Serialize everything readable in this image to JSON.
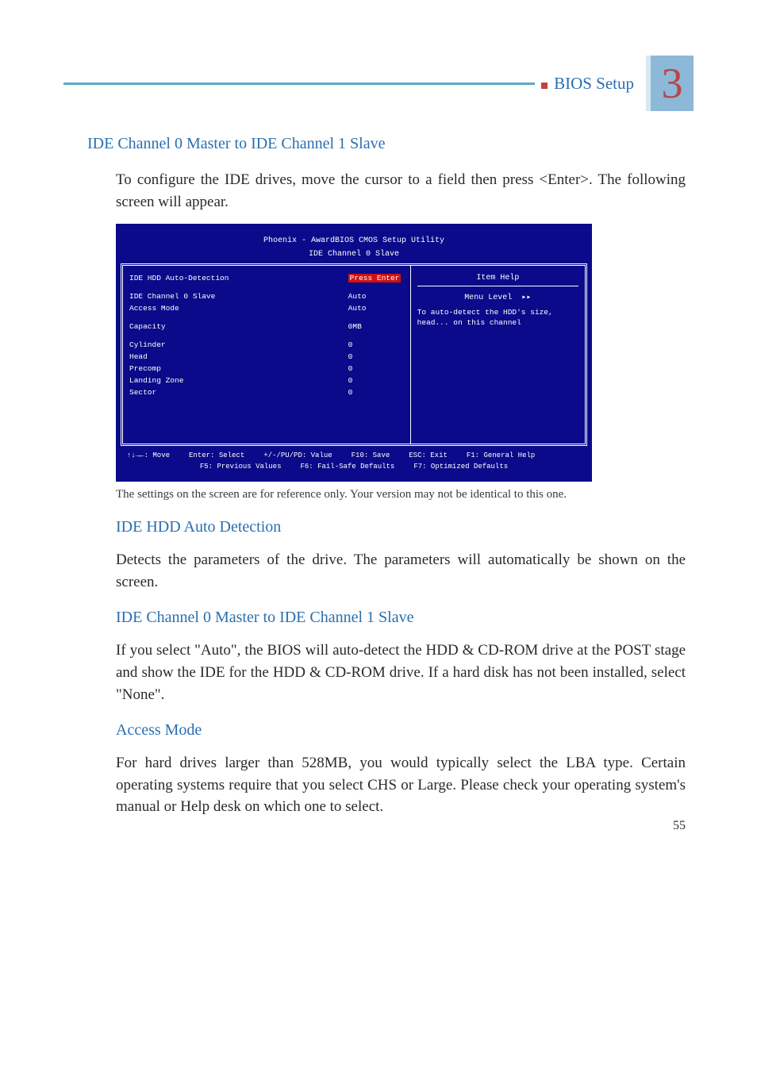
{
  "header": {
    "section": "BIOS Setup",
    "chapter": "3"
  },
  "section1": {
    "title": "IDE Channel 0 Master to IDE Channel 1 Slave",
    "intro": "To configure the IDE drives, move the cursor to a field then press <Enter>. The following screen will appear."
  },
  "bios": {
    "titlebar1": "Phoenix - AwardBIOS CMOS Setup Utility",
    "titlebar2": "IDE Channel 0 Slave",
    "rows": [
      {
        "label": "IDE HDD Auto-Detection",
        "value": "Press Enter",
        "highlight": true
      },
      {
        "label": "IDE Channel 0 Slave",
        "value": "Auto"
      },
      {
        "label": "Access Mode",
        "value": "Auto"
      },
      {
        "label": "Capacity",
        "value": "0MB"
      },
      {
        "label": "Cylinder",
        "value": "0"
      },
      {
        "label": "Head",
        "value": "0"
      },
      {
        "label": "Precomp",
        "value": "0"
      },
      {
        "label": "Landing Zone",
        "value": "0"
      },
      {
        "label": "Sector",
        "value": "0"
      }
    ],
    "help": {
      "title": "Item Help",
      "menuLevel": "Menu Level",
      "text": "To auto-detect the HDD's size, head... on this channel"
    },
    "footer": {
      "nav": "Move",
      "enter": "Enter: Select",
      "pupd": "+/-/PU/PD: Value",
      "f10": "F10: Save",
      "esc": "ESC: Exit",
      "f1": "F1: General Help",
      "f5": "F5: Previous Values",
      "f6": "F6: Fail-Safe Defaults",
      "f7": "F7: Optimized Defaults"
    }
  },
  "caption": "The settings on the screen are for reference only. Your version may not be identical to this one.",
  "section2": {
    "title": "IDE HDD Auto Detection",
    "text": "Detects the parameters of the drive. The parameters will automatically be shown on the screen."
  },
  "section3": {
    "title": "IDE Channel 0 Master to IDE Channel 1 Slave",
    "text": "If you select \"Auto\", the BIOS will auto-detect the HDD & CD-ROM drive at the POST stage and show the IDE for the HDD & CD-ROM drive. If a hard disk has not been installed, select \"None\"."
  },
  "section4": {
    "title": "Access Mode",
    "text": "For hard drives larger than 528MB, you would typically select the LBA type. Certain operating systems require that you select CHS or Large. Please check your operating system's manual or Help desk on which one to select."
  },
  "pageNumber": "55"
}
